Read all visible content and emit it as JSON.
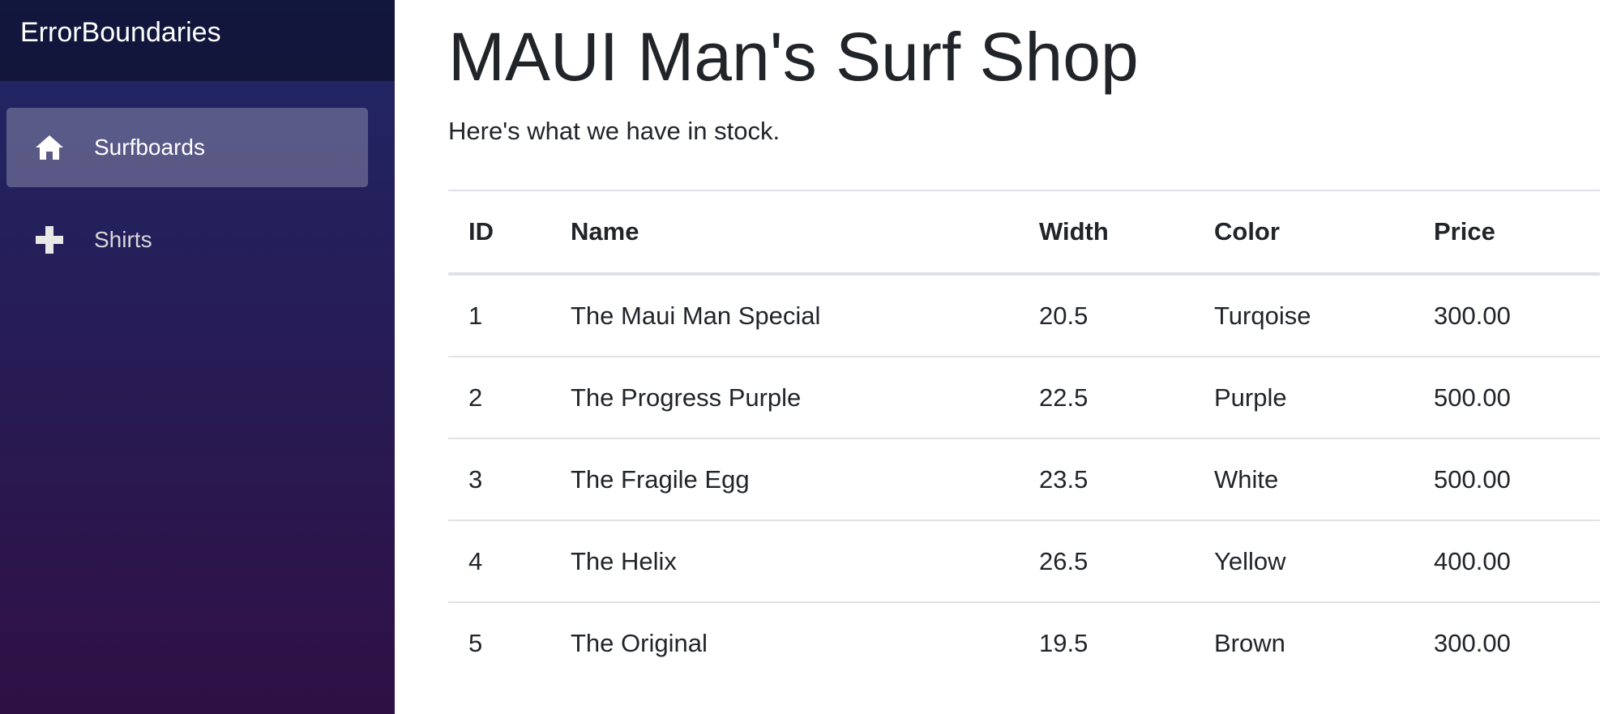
{
  "sidebar": {
    "brand": "ErrorBoundaries",
    "items": [
      {
        "label": "Surfboards",
        "icon": "home-icon",
        "active": true
      },
      {
        "label": "Shirts",
        "icon": "plus-icon",
        "active": false
      }
    ]
  },
  "main": {
    "title": "MAUI Man's Surf Shop",
    "subtitle": "Here's what we have in stock.",
    "table": {
      "headers": [
        "ID",
        "Name",
        "Width",
        "Color",
        "Price"
      ],
      "rows": [
        [
          "1",
          "The Maui Man Special",
          "20.5",
          "Turqoise",
          "300.00"
        ],
        [
          "2",
          "The Progress Purple",
          "22.5",
          "Purple",
          "500.00"
        ],
        [
          "3",
          "The Fragile Egg",
          "23.5",
          "White",
          "500.00"
        ],
        [
          "4",
          "The Helix",
          "26.5",
          "Yellow",
          "400.00"
        ],
        [
          "5",
          "The Original",
          "19.5",
          "Brown",
          "300.00"
        ]
      ]
    }
  },
  "colors": {
    "sidebar_top": "#1f2766",
    "sidebar_bottom": "#2f1044",
    "text": "#212529",
    "border": "#dee2e6"
  }
}
